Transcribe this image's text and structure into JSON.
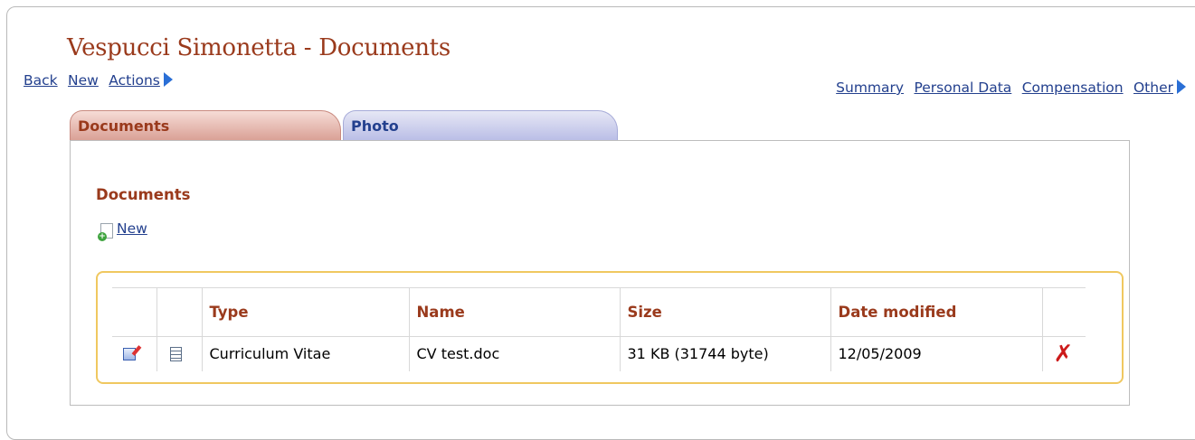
{
  "page": {
    "title": "Vespucci Simonetta - Documents"
  },
  "nav_left": {
    "back": "Back",
    "new": "New",
    "actions": "Actions"
  },
  "nav_right": {
    "summary": "Summary",
    "personal_data": "Personal Data",
    "compensation": "Compensation",
    "other": "Other"
  },
  "tabs": [
    {
      "label": "Documents"
    },
    {
      "label": "Photo"
    }
  ],
  "section": {
    "title": "Documents",
    "new_label": "New"
  },
  "table": {
    "headers": [
      "Type",
      "Name",
      "Size",
      "Date modified"
    ],
    "rows": [
      {
        "type": "Curriculum Vitae",
        "name": "CV test.doc",
        "size": "31 KB (31744 byte)",
        "date": "12/05/2009"
      }
    ]
  },
  "colors": {
    "title": "#9a3a1c",
    "link": "#23408e",
    "accent_border": "#f0c860",
    "delete": "#cc1a1a"
  },
  "icons": [
    "arrow-right-icon",
    "new-document-icon",
    "edit-icon",
    "document-icon",
    "delete-icon"
  ]
}
